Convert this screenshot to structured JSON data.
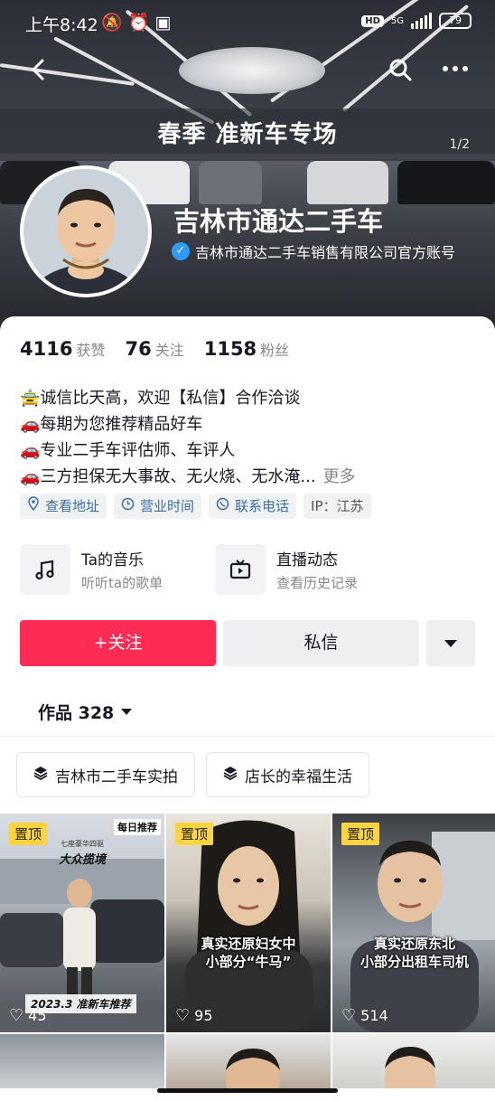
{
  "status_bar": {
    "time": "上午8:42",
    "hd": "HD",
    "network": "5G",
    "battery": "79"
  },
  "banner": {
    "title": "春季 准新车专场",
    "page_indicator": "1/2"
  },
  "profile": {
    "name": "吉林市通达二手车",
    "verified_text": "吉林市通达二手车销售有限公司官方账号"
  },
  "stats": [
    {
      "value": "4116",
      "label": "获赞"
    },
    {
      "value": "76",
      "label": "关注"
    },
    {
      "value": "1158",
      "label": "粉丝"
    }
  ],
  "bio": {
    "lines": [
      "🚖诚信比天高，欢迎【私信】合作洽谈",
      "🚗每期为您推荐精品好车",
      "🚗专业二手车评估师、车评人",
      "🚗三方担保无大事故、无火烧、无水淹..."
    ],
    "more": "更多"
  },
  "tags": {
    "address": "查看地址",
    "hours": "营业时间",
    "phone": "联系电话",
    "ip": "IP：江苏"
  },
  "features": {
    "music_title": "Ta的音乐",
    "music_sub": "听听ta的歌单",
    "live_title": "直播动态",
    "live_sub": "查看历史记录"
  },
  "actions": {
    "follow": "+关注",
    "message": "私信"
  },
  "works": {
    "label": "作品 328"
  },
  "collections": [
    "吉林市二手车实拍",
    "店长的幸福生活"
  ],
  "videos": [
    {
      "pin": "置顶",
      "likes": "45",
      "badge": "每日推荐",
      "sub": "七座豪华四驱",
      "title": "大众揽境",
      "date": "2023.3 准新车推荐"
    },
    {
      "pin": "置顶",
      "likes": "95",
      "overlay": [
        "真实还原妇女中",
        "小部分“牛马”"
      ]
    },
    {
      "pin": "置顶",
      "likes": "514",
      "overlay": [
        "真实还原东北",
        "小部分出租车司机"
      ]
    }
  ]
}
